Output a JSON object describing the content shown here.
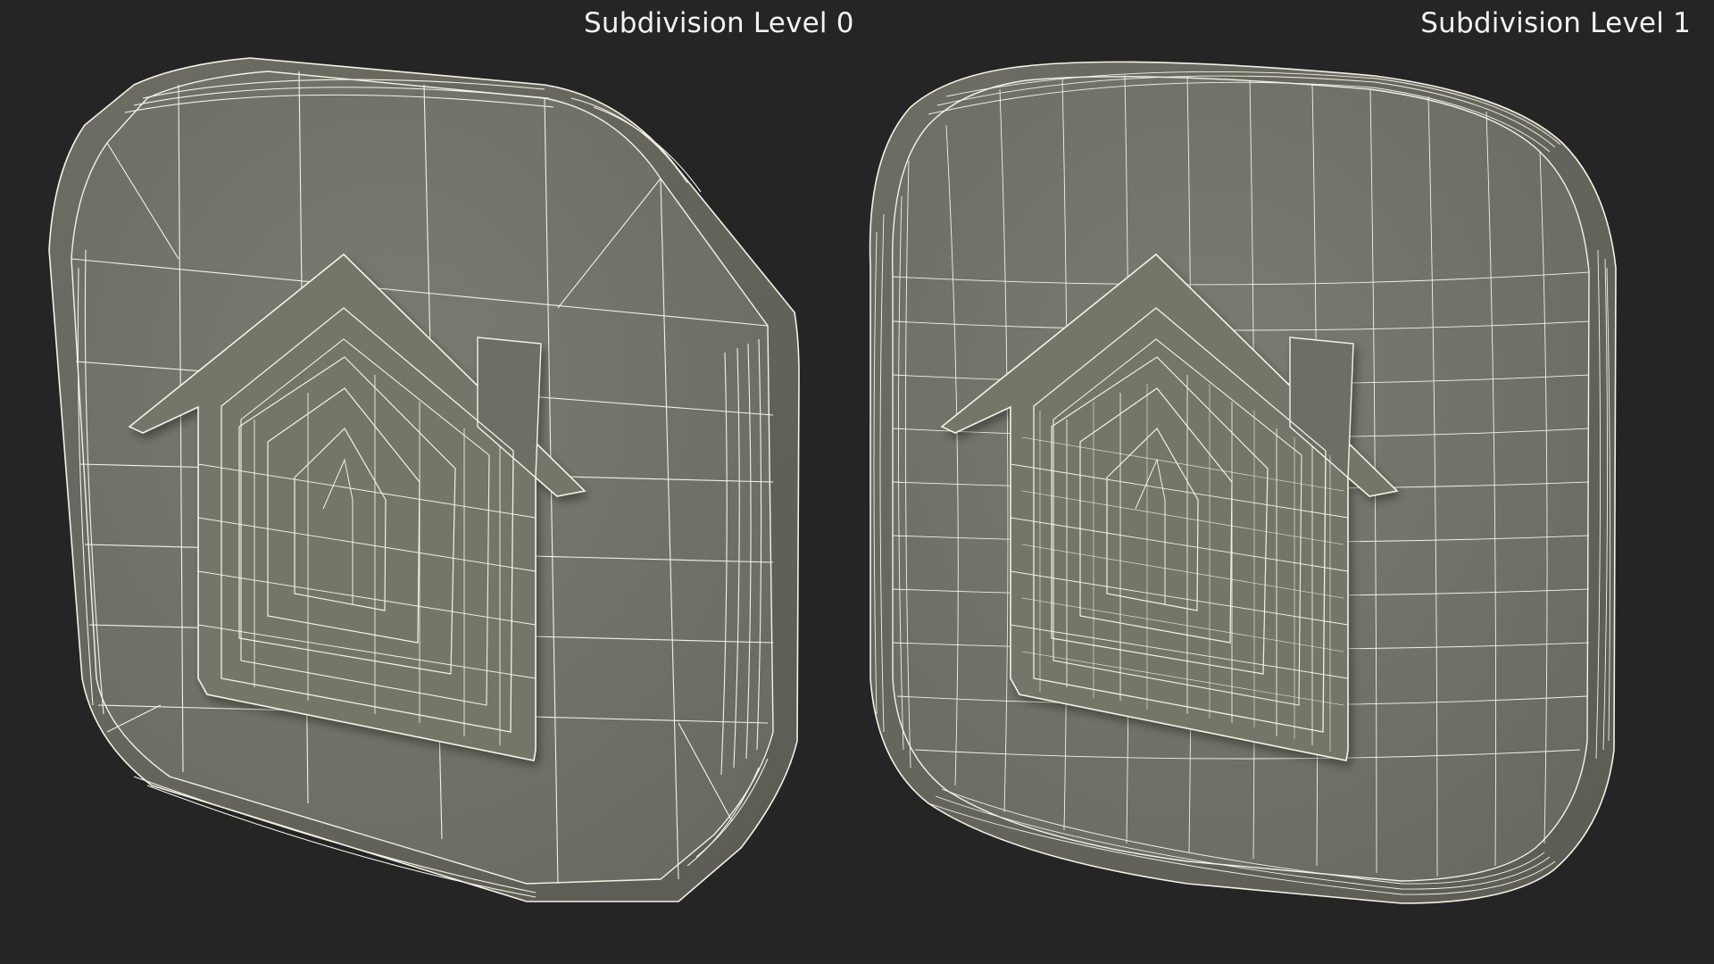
{
  "labels": {
    "left": "Subdivision Level 0",
    "right": "Subdivision Level 1"
  },
  "colors": {
    "background": "#252525",
    "surface": "#76766c",
    "wire": "#f2f2e6"
  },
  "renders": [
    {
      "model": "rounded-square-icon-with-house-emblem",
      "subdivision_level": 0
    },
    {
      "model": "rounded-square-icon-with-house-emblem",
      "subdivision_level": 1
    }
  ]
}
